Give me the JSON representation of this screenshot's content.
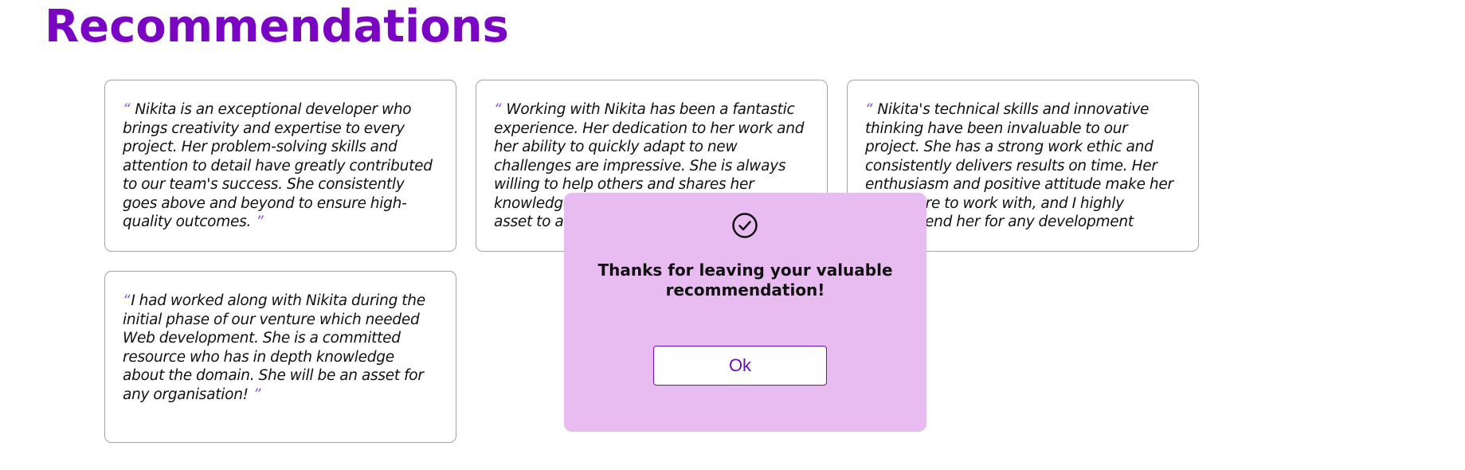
{
  "page": {
    "title": "Recommendations"
  },
  "quote_marks": {
    "open": "“",
    "close": "”"
  },
  "cards": [
    {
      "text": "Nikita is an exceptional developer who brings creativity and expertise to every project. Her problem-solving skills and attention to detail have greatly contributed to our team's success. She consistently goes above and beyond to ensure high-quality outcomes."
    },
    {
      "text": "Working with Nikita has been a fantastic experience. Her dedication to her work and her ability to quickly adapt to new challenges are impressive. She is always willing to help others and shares her knowledge freely. She would be a valuable asset to any team."
    },
    {
      "text": "Nikita's technical skills and innovative thinking have been invaluable to our project. She has a strong work ethic and consistently delivers results on time. Her enthusiasm and positive attitude make her a pleasure to work with, and I highly recommend her for any development role."
    },
    {
      "text": "I had worked along with Nikita during the initial phase of our venture which needed Web development. She is a committed resource who has in depth knowledge about the domain. She will be an asset for any organisation!"
    }
  ],
  "modal": {
    "icon": "check-circle-icon",
    "message": "Thanks for leaving your valuable recommendation!",
    "ok_label": "Ok"
  },
  "colors": {
    "title": "#7a06c3",
    "quote_mark": "#8f55e8",
    "modal_background": "#e8bbf1",
    "button_accent": "#6c12b8",
    "card_border": "#a5a5a5"
  }
}
